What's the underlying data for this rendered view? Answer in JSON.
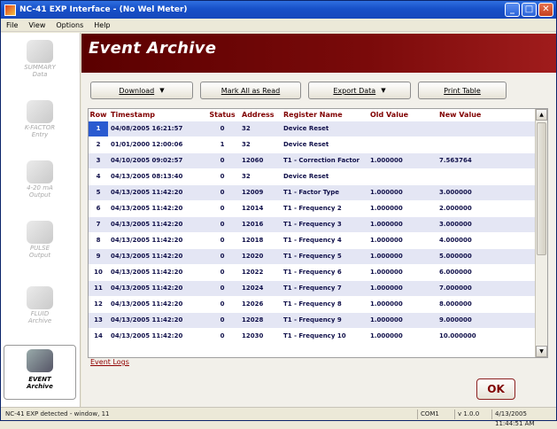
{
  "window": {
    "title": "NC-41 EXP Interface - (No Wel Meter)",
    "buttons": {
      "minimize": "_",
      "maximize": "□",
      "close": "✕"
    }
  },
  "menu": [
    "File",
    "View",
    "Options",
    "Help"
  ],
  "sidebar": {
    "items": [
      {
        "label": "SUMMARY\nData",
        "icon": "meter-icon"
      },
      {
        "label": "K-FACTOR\nEntry",
        "icon": "kfactor-icon"
      },
      {
        "label": "4-20 mA\nOutput",
        "icon": "current-icon"
      },
      {
        "label": "PULSE\nOutput",
        "icon": "pulse-icon"
      },
      {
        "label": "FLUID\nArchive",
        "icon": "fluid-icon"
      },
      {
        "label": "EVENT\nArchive",
        "icon": "event-icon",
        "active": true
      }
    ]
  },
  "header": {
    "title": "Event Archive"
  },
  "toolbar": {
    "download": "Download",
    "mark_all": "Mark All as Read",
    "export": "Export Data",
    "print": "Print Table"
  },
  "table": {
    "columns": [
      "Row",
      "Timestamp",
      "Status",
      "Address",
      "Register Name",
      "Old Value",
      "New Value"
    ],
    "rows": [
      [
        "1",
        "04/08/2005 16:21:57",
        "0",
        "32",
        "Device Reset",
        "",
        ""
      ],
      [
        "2",
        "01/01/2000 12:00:06",
        "1",
        "32",
        "Device Reset",
        "",
        ""
      ],
      [
        "3",
        "04/10/2005 09:02:57",
        "0",
        "12060",
        "T1 - Correction Factor",
        "1.000000",
        "7.563764"
      ],
      [
        "4",
        "04/13/2005 08:13:40",
        "0",
        "32",
        "Device Reset",
        "",
        ""
      ],
      [
        "5",
        "04/13/2005 11:42:20",
        "0",
        "12009",
        "T1 - Factor Type",
        "1.000000",
        "3.000000"
      ],
      [
        "6",
        "04/13/2005 11:42:20",
        "0",
        "12014",
        "T1 - Frequency 2",
        "1.000000",
        "2.000000"
      ],
      [
        "7",
        "04/13/2005 11:42:20",
        "0",
        "12016",
        "T1 - Frequency 3",
        "1.000000",
        "3.000000"
      ],
      [
        "8",
        "04/13/2005 11:42:20",
        "0",
        "12018",
        "T1 - Frequency 4",
        "1.000000",
        "4.000000"
      ],
      [
        "9",
        "04/13/2005 11:42:20",
        "0",
        "12020",
        "T1 - Frequency 5",
        "1.000000",
        "5.000000"
      ],
      [
        "10",
        "04/13/2005 11:42:20",
        "0",
        "12022",
        "T1 - Frequency 6",
        "1.000000",
        "6.000000"
      ],
      [
        "11",
        "04/13/2005 11:42:20",
        "0",
        "12024",
        "T1 - Frequency 7",
        "1.000000",
        "7.000000"
      ],
      [
        "12",
        "04/13/2005 11:42:20",
        "0",
        "12026",
        "T1 - Frequency 8",
        "1.000000",
        "8.000000"
      ],
      [
        "13",
        "04/13/2005 11:42:20",
        "0",
        "12028",
        "T1 - Frequency 9",
        "1.000000",
        "9.000000"
      ],
      [
        "14",
        "04/13/2005 11:42:20",
        "0",
        "12030",
        "T1 - Frequency 10",
        "1.000000",
        "10.000000"
      ]
    ],
    "selected_row": 0
  },
  "links": {
    "event_logs": "Event Logs"
  },
  "ok_button": "OK",
  "status": {
    "message": "NC-41 EXP detected - window, 11",
    "port": "COM1",
    "version": "v 1.0.0",
    "datetime": "4/13/2005 11:44:51 AM"
  },
  "colors": {
    "banner": "#7a0a0a",
    "header_text": "#800000",
    "row_alt": "#e4e6f4",
    "selection": "#2a5ad0"
  }
}
